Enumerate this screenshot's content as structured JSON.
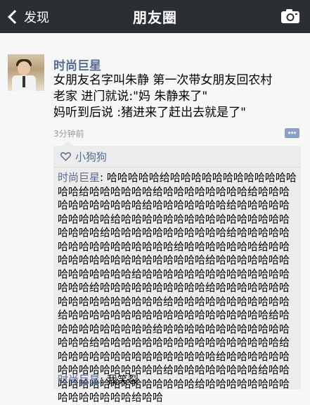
{
  "nav": {
    "back_label": "发现",
    "title": "朋友圈"
  },
  "post": {
    "author": "时尚巨星",
    "text_line1": "女朋友名字叫朱静 第一次带女朋友回农村",
    "text_line2": "老家 进门就说:\"妈 朱静来了\"",
    "text_line3": "妈听到后说 :猪进来了赶出去就是了\"",
    "time": "3分钟前"
  },
  "likes": {
    "names": "小狗狗"
  },
  "comments": [
    {
      "author": "时尚巨星",
      "sep": ": ",
      "text": "哈哈哈哈哈给哈哈哈哈哈哈哈哈哈哈哈哈哈哈给哈哈哈哈哈哈给哈哈哈哈哈哈哈哈给哈哈哈哈哈哈哈哈哈哈哈给哈哈哈哈哈哈哈给哈哈哈哈哈哈哈哈哈哈给哈哈哈哈哈哈哈哈哈哈哈哈哈哈哈哈哈哈哈哈给哈哈哈哈哈哈哈哈哈哈哈给哈哈哈哈哈哈哈哈哈哈哈哈哈哈哈哈给哈哈哈哈哈哈哈给哈哈哈哈哈哈哈哈哈哈哈哈哈哈哈哈给哈哈哈哈哈哈哈哈哈哈哈哈哈哈给哈哈哈哈哈哈哈哈哈哈哈哈哈哈哈哈哈给哈哈哈哈哈哈哈哈哈哈给哈哈哈哈哈哈哈哈哈哈哈哈哈哈哈哈哈给哈哈哈哈哈哈哈哈哈哈哈给哈哈哈哈哈哈哈哈哈哈哈哈哈哈哈哈哈哈哈给哈哈哈哈哈哈哈哈哈哈给哈哈哈哈哈哈哈哈哈哈哈哈哈哈哈给哈哈哈哈哈哈哈哈哈哈哈哈哈哈哈哈哈给哈哈哈哈哈哈哈哈哈哈哈哈哈哈哈给哈哈哈哈哈哈哈哈哈哈哈哈哈哈哈哈给哈哈哈哈哈哈哈哈给哈哈哈哈哈哈哈哈哈哈哈哈哈哈哈给哈哈哈哈哈哈哈哈哈哈哈哈哈哈哈给哈哈"
    },
    {
      "author": "时尚巨星",
      "sep": ": ",
      "text": "我笑裂"
    }
  ],
  "icons": {
    "back": "chevron-left-icon",
    "camera": "camera-icon",
    "like": "heart-icon",
    "comment": "comment-icon"
  },
  "colors": {
    "nav_bg": "#2b2f33",
    "link": "#576b95",
    "panel_bg": "#ececec"
  }
}
